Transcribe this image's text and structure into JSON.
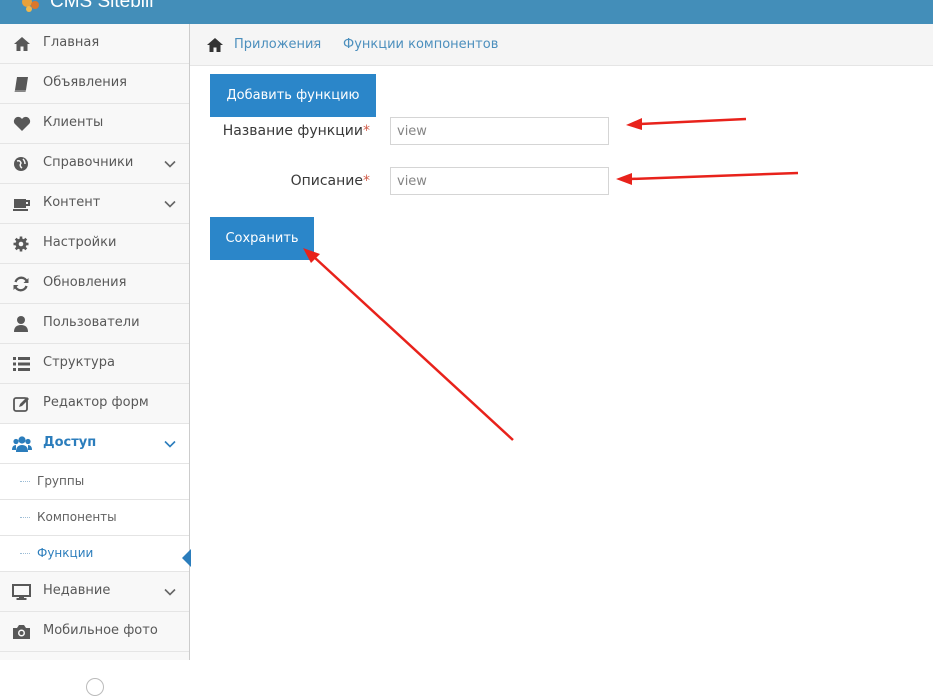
{
  "app": {
    "title": "CMS Sitebill"
  },
  "colors": {
    "topbar": "#438eb9",
    "primary_button": "#2b86c9",
    "active": "#2b7dbc",
    "required": "#d15b47",
    "arrow": "#e8221b"
  },
  "sidebar": {
    "items": [
      {
        "label": "Главная",
        "icon": "home-icon"
      },
      {
        "label": "Объявления",
        "icon": "book-icon"
      },
      {
        "label": "Клиенты",
        "icon": "heart-icon"
      },
      {
        "label": "Справочники",
        "icon": "globe-icon",
        "has_children": true
      },
      {
        "label": "Контент",
        "icon": "coffee-icon",
        "has_children": true
      },
      {
        "label": "Настройки",
        "icon": "gear-icon"
      },
      {
        "label": "Обновления",
        "icon": "refresh-icon"
      },
      {
        "label": "Пользователи",
        "icon": "user-icon"
      },
      {
        "label": "Структура",
        "icon": "list-icon"
      },
      {
        "label": "Редактор форм",
        "icon": "edit-icon"
      },
      {
        "label": "Доступ",
        "icon": "users-icon",
        "has_children": true,
        "expanded": true,
        "children": [
          {
            "label": "Группы"
          },
          {
            "label": "Компоненты"
          },
          {
            "label": "Функции",
            "active": true
          }
        ]
      },
      {
        "label": "Недавние",
        "icon": "desktop-icon",
        "has_children": true
      },
      {
        "label": "Мобильное фото",
        "icon": "camera-icon"
      }
    ]
  },
  "breadcrumb": {
    "items": [
      "Приложения",
      "Функции компонентов"
    ]
  },
  "page": {
    "add_button": "Добавить функцию",
    "fields": [
      {
        "label": "Название функции",
        "required_mark": "*",
        "value": "view"
      },
      {
        "label": "Описание",
        "required_mark": "*",
        "value": "view"
      }
    ],
    "save_button": "Сохранить"
  }
}
